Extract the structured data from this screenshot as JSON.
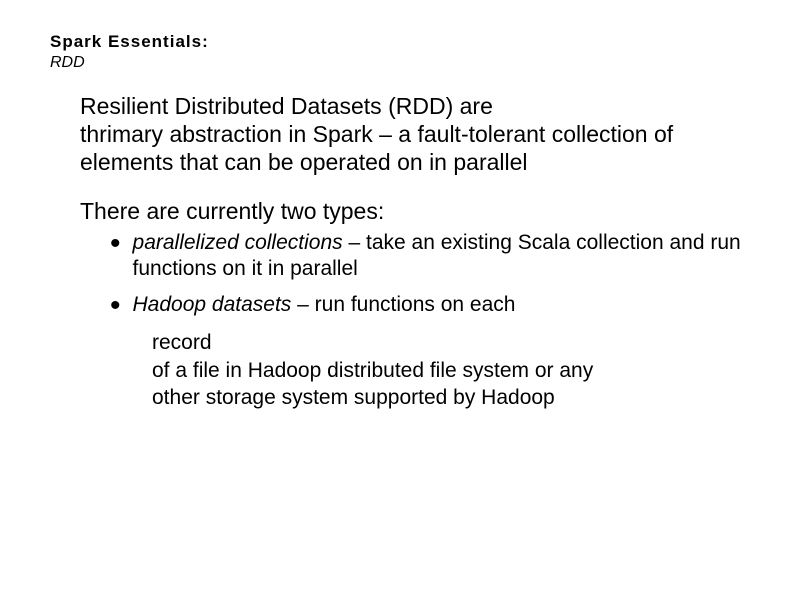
{
  "header": {
    "title": "Spark Essentials:",
    "sub": "RDD"
  },
  "main": {
    "p1_line1": "Resilient Distributed Datasets (RDD) are",
    "p1_line2": "thrimary abstraction in Spark – a fault-tolerant collection of elements that can be operated on in parallel",
    "p2": "There are currently two types:"
  },
  "bullets": [
    {
      "ital": "parallelized collections",
      "rest": " – take an existing Scala collection and run functions on it in parallel",
      "cont": ""
    },
    {
      "ital": "Hadoop datasets",
      "rest": " – run functions on each",
      "cont": "record\nof a file in Hadoop distributed file system or any\nother storage system supported by Hadoop"
    }
  ]
}
